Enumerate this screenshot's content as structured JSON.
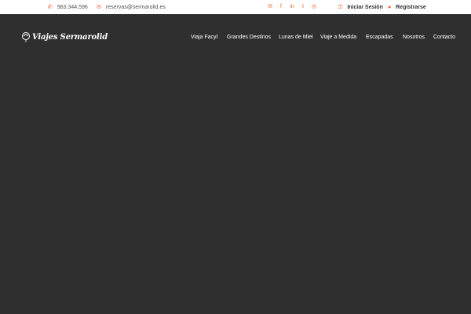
{
  "topbar": {
    "phone": "983.344.596",
    "email": "reservas@sermarolid.es",
    "social": [
      {
        "icon": "envelope-icon",
        "glyph": "✉"
      },
      {
        "icon": "facebook-icon",
        "glyph": "f"
      },
      {
        "icon": "linkedin-icon",
        "glyph": "in"
      },
      {
        "icon": "twitter-icon",
        "glyph": "t"
      },
      {
        "icon": "instagram-icon",
        "glyph": "◎"
      }
    ],
    "login_label": "Iniciar Sesión",
    "register_label": "Registrarse"
  },
  "brand": {
    "name": "Viajes Sermarolid"
  },
  "nav": {
    "items": [
      {
        "label": "Viaja Facyl"
      },
      {
        "label": "Grandes Destinos"
      },
      {
        "label": "Lunas de Miel"
      },
      {
        "label": "Viaje a Medida"
      },
      {
        "label": "Escapadas"
      },
      {
        "label": "Nosotros"
      },
      {
        "label": "Contacto"
      }
    ]
  },
  "colors": {
    "accent": "#e8672e",
    "header_bg": "#2f2f2f",
    "topbar_bg": "#ffffff"
  }
}
